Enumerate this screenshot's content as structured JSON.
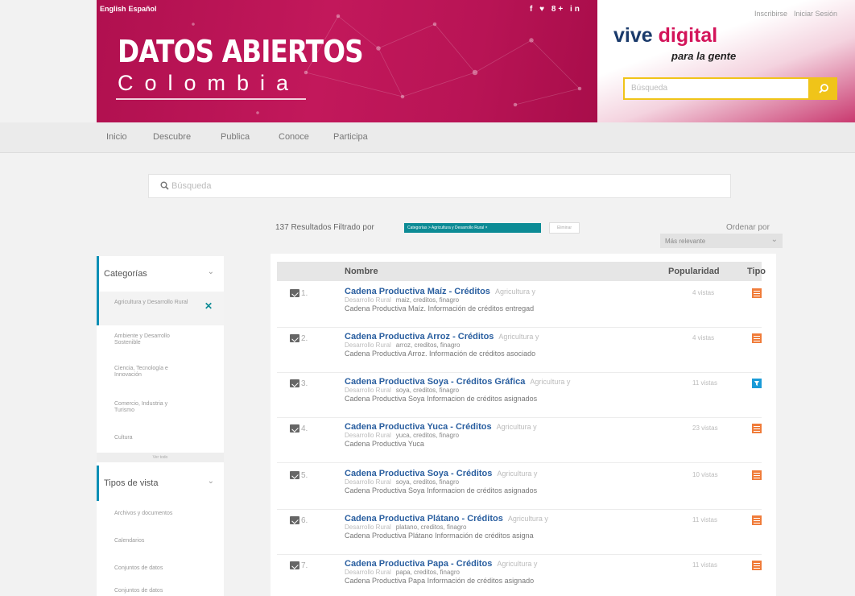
{
  "banner": {
    "languages": [
      "English",
      "Español"
    ],
    "social": "f ♥ 8+ in",
    "title": "DATOS ABIERTOS",
    "subtitle": "Colombia",
    "top_links": [
      "Inscribirse",
      "Iniciar Sesión"
    ],
    "vive": "vive",
    "digital": "digital",
    "gente": "para la gente",
    "search_placeholder": "Búsqueda"
  },
  "nav": [
    "Inicio",
    "Descubre",
    "Publica",
    "Conoce",
    "Participa"
  ],
  "main_search": {
    "placeholder": "Búsqueda"
  },
  "results_meta": {
    "count_text": "137 Resultados Filtrado por",
    "filter_chip": "Categorías > Agricultura y Desarrollo Rural ×",
    "clear": "Eliminar",
    "sort_label": "Ordenar por",
    "sort_value": "Más relevante"
  },
  "sidebar": {
    "categorias_title": "Categorías",
    "categorias": [
      "Agricultura y Desarrollo Rural",
      "Ambiente y Desarrollo Sostenible",
      "Ciencia, Tecnología e Innovación",
      "Comercio, Industria y Turismo",
      "Cultura"
    ],
    "ver_todo": "Ver todo",
    "tipos_title": "Tipos de vista",
    "tipos": [
      "Archivos y documentos",
      "Calendarios",
      "Conjuntos de datos",
      "Conjuntos de datos"
    ]
  },
  "table": {
    "headers": {
      "nombre": "Nombre",
      "popularidad": "Popularidad",
      "tipo": "Tipo"
    },
    "rows": [
      {
        "num": "1.",
        "title": "Cadena Productiva Maíz - Créditos",
        "cat1": "Agricultura y",
        "cat2": "Desarrollo Rural",
        "tags": "maiz, creditos, finagro",
        "desc": "Cadena Productiva Maíz. Información de créditos entregad",
        "pop": "4 vistas",
        "type": "table"
      },
      {
        "num": "2.",
        "title": "Cadena Productiva Arroz - Créditos",
        "cat1": "Agricultura y",
        "cat2": "Desarrollo Rural",
        "tags": "arroz, creditos, finagro",
        "desc": "Cadena Productiva Arroz. Información de créditos asociado",
        "pop": "4 vistas",
        "type": "table"
      },
      {
        "num": "3.",
        "title": "Cadena Productiva Soya - Créditos Gráfica",
        "cat1": "Agricultura y",
        "cat2": "Desarrollo Rural",
        "tags": "soya, creditos, finagro",
        "desc": "Cadena Productiva Soya Informacion de créditos asignados",
        "pop": "11 vistas",
        "type": "filter"
      },
      {
        "num": "4.",
        "title": "Cadena Productiva Yuca - Créditos",
        "cat1": "Agricultura y",
        "cat2": "Desarrollo Rural",
        "tags": "yuca, creditos, finagro",
        "desc": "Cadena Productiva Yuca",
        "pop": "23 vistas",
        "type": "table"
      },
      {
        "num": "5.",
        "title": "Cadena Productiva Soya - Créditos",
        "cat1": "Agricultura y",
        "cat2": "Desarrollo Rural",
        "tags": "soya, creditos, finagro",
        "desc": "Cadena Productiva Soya Informacion de créditos asignados",
        "pop": "10 vistas",
        "type": "table"
      },
      {
        "num": "6.",
        "title": "Cadena Productiva Plátano - Créditos",
        "cat1": "Agricultura y",
        "cat2": "Desarrollo Rural",
        "tags": "platano, creditos, finagro",
        "desc": "Cadena Productiva Plátano Información de créditos asigna",
        "pop": "11 vistas",
        "type": "table"
      },
      {
        "num": "7.",
        "title": "Cadena Productiva Papa - Créditos",
        "cat1": "Agricultura y",
        "cat2": "Desarrollo Rural",
        "tags": "papa, creditos, finagro",
        "desc": "Cadena Productiva Papa Información de créditos asignado",
        "pop": "11 vistas",
        "type": "table"
      }
    ]
  },
  "colors": {
    "brand_pink": "#c2185b",
    "accent_teal": "#0c8b95",
    "link_blue": "#2a5fa0",
    "search_yellow": "#f0c419",
    "type_orange": "#f07c3a",
    "type_blue": "#1a9bd7"
  }
}
